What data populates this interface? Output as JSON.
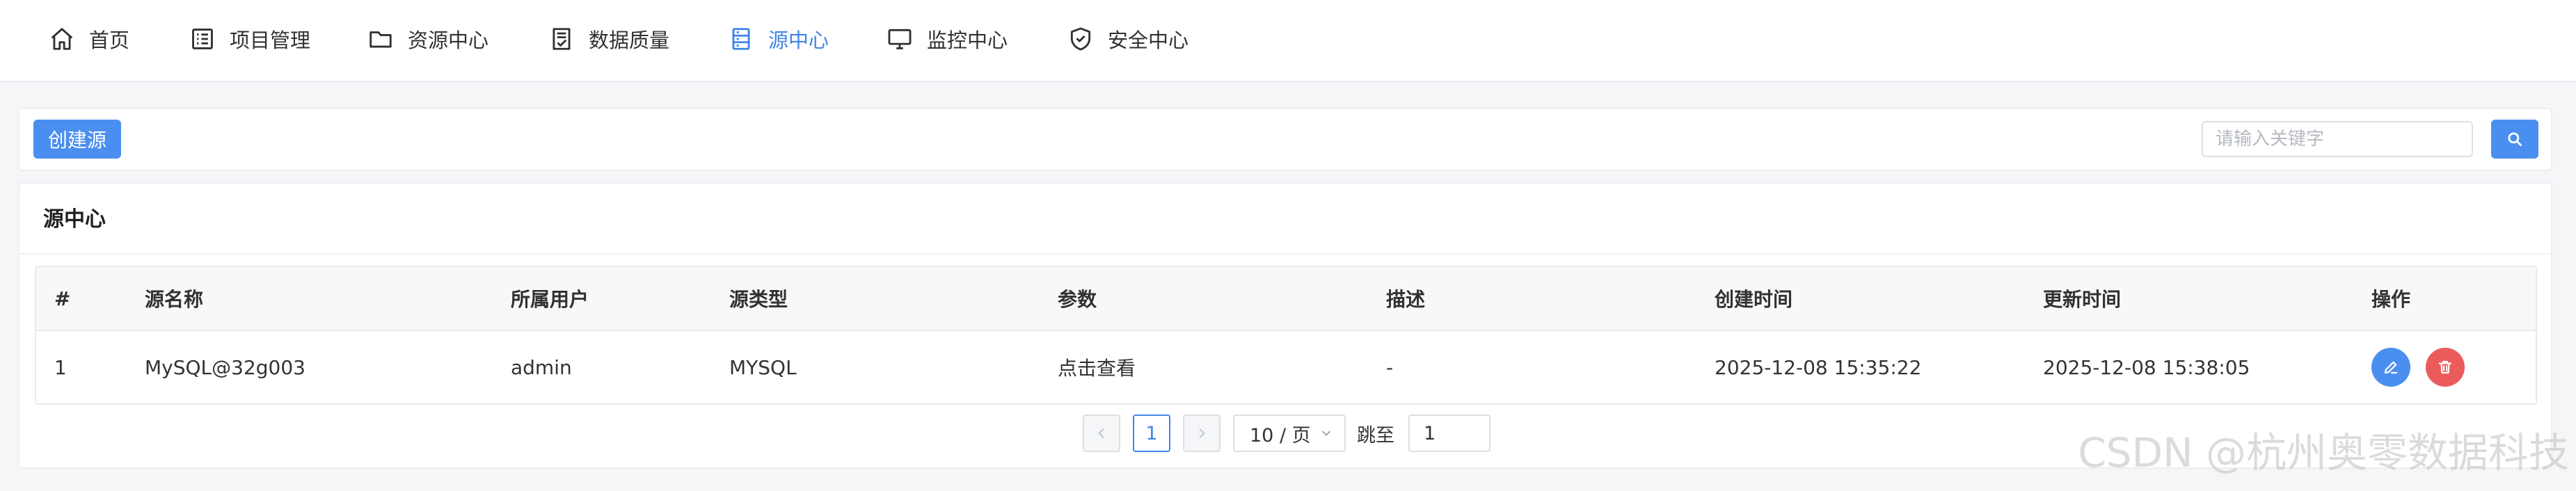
{
  "nav": {
    "items": [
      {
        "label": "首页",
        "icon": "home-icon"
      },
      {
        "label": "项目管理",
        "icon": "list-icon"
      },
      {
        "label": "资源中心",
        "icon": "folder-icon"
      },
      {
        "label": "数据质量",
        "icon": "document-check-icon"
      },
      {
        "label": "源中心",
        "icon": "database-icon",
        "active": true
      },
      {
        "label": "监控中心",
        "icon": "monitor-icon"
      },
      {
        "label": "安全中心",
        "icon": "shield-check-icon"
      }
    ],
    "accent_color": "#3f85e6"
  },
  "toolbar": {
    "create_label": "创建源",
    "search_placeholder": "请输入关键字",
    "search_value": ""
  },
  "main": {
    "title": "源中心",
    "table": {
      "columns": [
        "#",
        "源名称",
        "所属用户",
        "源类型",
        "参数",
        "描述",
        "创建时间",
        "更新时间",
        "操作"
      ],
      "rows": [
        {
          "index": "1",
          "name": "MySQL@32g003",
          "user": "admin",
          "type": "MYSQL",
          "params": "点击查看",
          "desc": "-",
          "created": "2025-12-08 15:35:22",
          "updated": "2025-12-08 15:38:05"
        }
      ]
    },
    "pagination": {
      "current_page": "1",
      "page_size": "10 / 页",
      "jump_label": "跳至",
      "jump_value": "1"
    }
  },
  "watermark": "CSDN @杭州奥零数据科技"
}
